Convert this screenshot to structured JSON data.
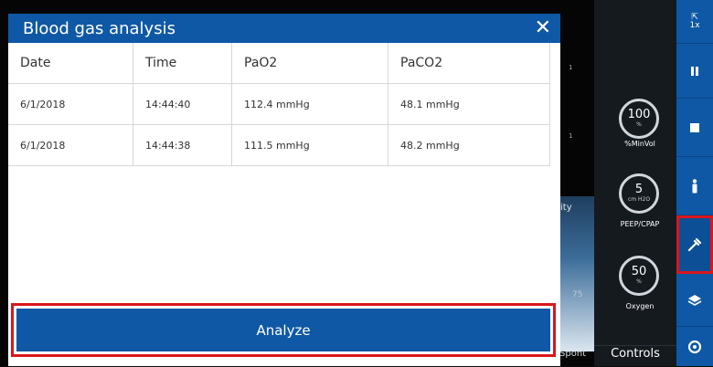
{
  "dialog": {
    "title": "Blood gas analysis",
    "close_glyph": "✕",
    "columns": [
      "Date",
      "Time",
      "PaO2",
      "PaCO2"
    ],
    "rows": [
      {
        "date": "6/1/2018",
        "time": "14:44:40",
        "pao2": "112.4 mmHg",
        "paco2": "48.1 mmHg"
      },
      {
        "date": "6/1/2018",
        "time": "14:44:38",
        "pao2": "111.5 mmHg",
        "paco2": "48.2 mmHg"
      }
    ],
    "analyze_label": "Analyze"
  },
  "background": {
    "strip_label": "ity",
    "tick_75": "75",
    "tick_100": "100",
    "mode_label": "Spont"
  },
  "controls": {
    "knobs": [
      {
        "value": "100",
        "unit": "%",
        "label": "%MinVol"
      },
      {
        "value": "5",
        "unit": "cm H2O",
        "label": "PEEP/CPAP"
      },
      {
        "value": "50",
        "unit": "%",
        "label": "Oxygen"
      }
    ],
    "footer_label": "Controls"
  },
  "sidebar": {
    "zoom_label": "1x",
    "buttons": [
      "zoom-icon",
      "pause-icon",
      "stop-icon",
      "patient-icon",
      "tools-icon",
      "layers-icon",
      "target-icon"
    ],
    "active_button": "tools-icon"
  },
  "colors": {
    "accent_blue": "#0f58a5",
    "highlight_red": "#d9161c"
  }
}
